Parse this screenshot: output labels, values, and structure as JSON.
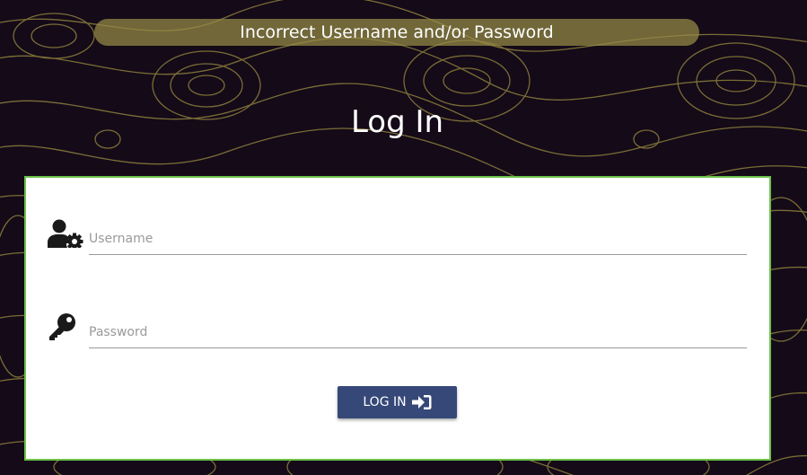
{
  "alert": {
    "message": "Incorrect Username and/or Password"
  },
  "header": {
    "title": "Log In"
  },
  "form": {
    "username": {
      "placeholder": "Username",
      "value": "",
      "icon": "user-gear-icon"
    },
    "password": {
      "placeholder": "Password",
      "value": "",
      "icon": "key-icon"
    },
    "submit": {
      "label": "LOG IN",
      "icon": "sign-in-icon"
    }
  },
  "colors": {
    "background": "#150a18",
    "contour_lines": "#8c7f3c",
    "alert_background": "#968c46",
    "card_border": "#6cc24a",
    "button": "#354878"
  }
}
